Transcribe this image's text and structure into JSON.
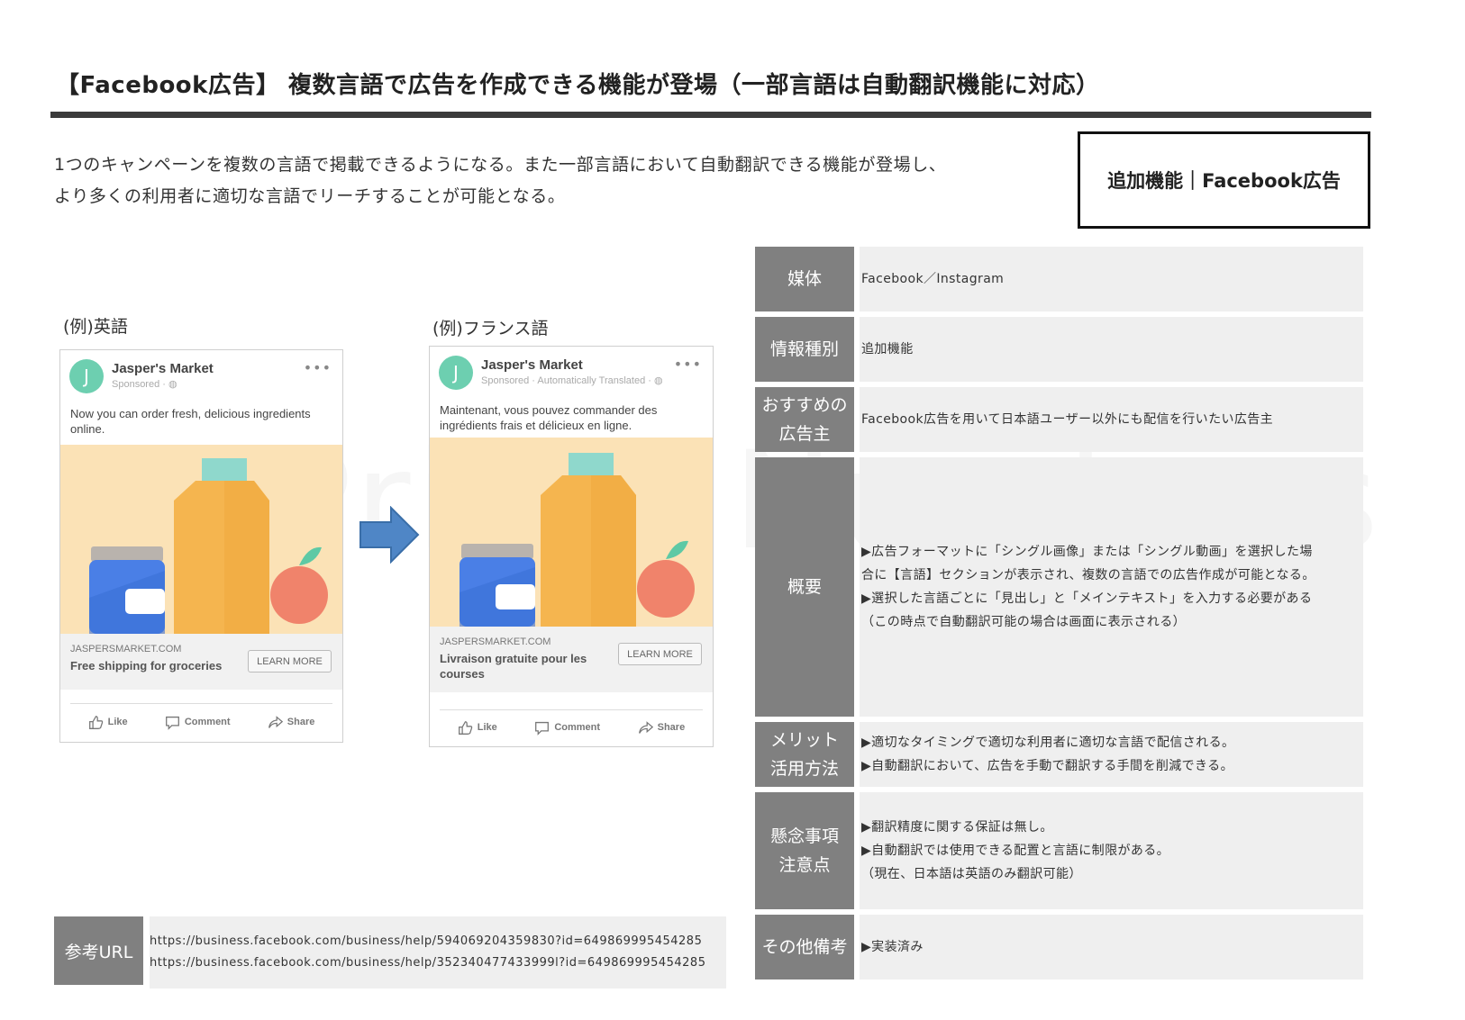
{
  "title": "【Facebook広告】 複数言語で広告を作成できる機能が登場（一部言語は自動翻訳機能に対応）",
  "intro": {
    "line1": "1つのキャンペーンを複数の言語で掲載できるようになる。また一部言語において自動翻訳できる機能が登場し、",
    "line2": "より多くの利用者に適切な言語でリーチすることが可能となる。"
  },
  "tag": "追加機能｜Facebook広告",
  "watermark": "Prime Numbers",
  "examples": [
    {
      "caption": "(例)英語",
      "page_name": "Jasper's Market",
      "sponsored": "Sponsored · ",
      "body": "Now you can order fresh, delicious ingredients online.",
      "domain": "JASPERSMARKET.COM",
      "headline": "Free shipping for groceries",
      "cta": "LEARN MORE",
      "actions": {
        "like": "Like",
        "comment": "Comment",
        "share": "Share"
      }
    },
    {
      "caption": "(例)フランス語",
      "page_name": "Jasper's Market",
      "sponsored": "Sponsored · Automatically Translated · ",
      "body": "Maintenant, vous pouvez commander des ingrédients frais et délicieux en ligne.",
      "domain": "JASPERSMARKET.COM",
      "headline": "Livraison gratuite pour les courses",
      "cta": "LEARN MORE",
      "actions": {
        "like": "Like",
        "comment": "Comment",
        "share": "Share"
      }
    }
  ],
  "info": {
    "media": {
      "label": "媒体",
      "value": "Facebook／Instagram"
    },
    "type": {
      "label": "情報種別",
      "value": "追加機能"
    },
    "advertiser": {
      "label1": "おすすめの",
      "label2": "広告主",
      "value": "Facebook広告を用いて日本語ユーザー以外にも配信を行いたい広告主"
    },
    "overview": {
      "label": "概要",
      "lines": [
        "▶広告フォーマットに「シングル画像」または「シングル動画」を選択した場",
        "合に【言語】セクションが表示され、複数の言語での広告作成が可能となる。",
        "▶選択した言語ごとに「見出し」と「メインテキスト」を入力する必要がある",
        "（この時点で自動翻訳可能の場合は画面に表示される）"
      ]
    },
    "merit": {
      "label1": "メリット",
      "label2": "活用方法",
      "lines": [
        "▶適切なタイミングで適切な利用者に適切な言語で配信される。",
        "▶自動翻訳において、広告を手動で翻訳する手間を削減できる。"
      ]
    },
    "concerns": {
      "label1": "懸念事項",
      "label2": "注意点",
      "lines": [
        "▶翻訳精度に関する保証は無し。",
        "▶自動翻訳では使用できる配置と言語に制限がある。",
        "（現在、日本語は英語のみ翻訳可能）"
      ]
    },
    "notes": {
      "label": "その他備考",
      "value": "▶実装済み"
    }
  },
  "reference": {
    "label": "参考URL",
    "urls": [
      "https://business.facebook.com/business/help/594069204359830?id=649869995454285",
      "https://business.facebook.com/business/help/352340477433999l?id=649869995454285"
    ]
  },
  "colors": {
    "label_bg": "#808080",
    "value_bg": "#efefef",
    "rule": "#3b3b3b",
    "avatar": "#6dcfb0",
    "arrow": "#4f86c6",
    "image_bg": "#fbe2b6",
    "bottle": "#f5b54f",
    "cap": "#8fd8cc",
    "jar": "#4a7fe6",
    "jar_lid": "#b9b3ad",
    "apple": "#f0836b",
    "leaf": "#5ec9a5"
  }
}
